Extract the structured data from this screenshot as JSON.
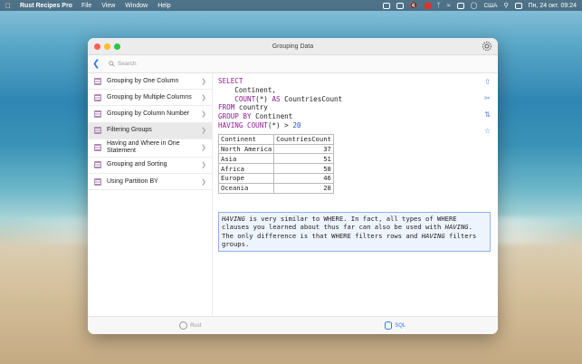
{
  "menubar": {
    "app_name": "Rust Recipes Pro",
    "menus": [
      "File",
      "View",
      "Window",
      "Help"
    ],
    "lang": "США",
    "datetime": "Пн, 24 окт. 09:24"
  },
  "window": {
    "title": "Grouping Data",
    "search_placeholder": "Search"
  },
  "sidebar": {
    "items": [
      {
        "label": "Grouping by One Column"
      },
      {
        "label": "Grouping by Multiple Columns"
      },
      {
        "label": "Grouping by Column Number"
      },
      {
        "label": "Filtering Groups",
        "active": true
      },
      {
        "label": "Having and Where in One Statement"
      },
      {
        "label": "Grouping and Sorting"
      },
      {
        "label": "Using Partition BY"
      }
    ]
  },
  "code": {
    "l1_kw": "SELECT",
    "l2": "    Continent,",
    "l3_fn": "    COUNT",
    "l3_rest": "(*) ",
    "l3_kw": "AS",
    "l3_alias": " CountriesCount",
    "l4_kw": "FROM",
    "l4_rest": " country",
    "l5_kw": "GROUP BY",
    "l5_rest": " Continent",
    "l6_kw": "HAVING",
    "l6_fn": " COUNT",
    "l6_rest": "(*) > ",
    "l6_num": "20"
  },
  "table": {
    "headers": [
      "Continent",
      "CountriesCount"
    ],
    "rows": [
      [
        "North America",
        "37"
      ],
      [
        "Asia",
        "51"
      ],
      [
        "Africa",
        "58"
      ],
      [
        "Europe",
        "46"
      ],
      [
        "Oceania",
        "28"
      ]
    ]
  },
  "note": {
    "p1": "HAVING",
    "p2": " is very similar to WHERE. In fact, all types of WHERE clauses you learned about thus far can also be used with ",
    "p3": "HAVING",
    "p4": ". The only difference is that WHERE filters rows and ",
    "p5": "HAVING",
    "p6": " filters groups."
  },
  "bottom_tabs": [
    {
      "label": "Rust"
    },
    {
      "label": "SQL",
      "active": true
    }
  ],
  "colors": {
    "accent": "#2f7cf6",
    "keyword": "#8b1d8b",
    "number": "#1f4fd6",
    "note_border": "#8fb2e8"
  }
}
